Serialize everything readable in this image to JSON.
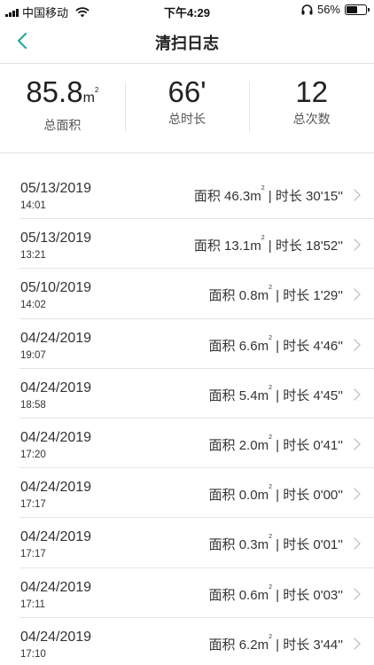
{
  "status_bar": {
    "carrier": "中国移动",
    "time": "下午4:29",
    "battery": "56%",
    "battery_level": 0.56
  },
  "nav": {
    "title": "清扫日志",
    "back_icon": "chevron-left-icon"
  },
  "summary": {
    "area_value": "85.8",
    "area_unit": "m",
    "area_unit_sup": "2",
    "area_label": "总面积",
    "duration_value": "66'",
    "duration_label": "总时长",
    "count_value": "12",
    "count_label": "总次数"
  },
  "colors": {
    "accent": "#2aa89a"
  },
  "logs": [
    {
      "date": "05/13/2019",
      "time": "14:01",
      "area_prefix": "面积 46.3m",
      "sup": "2",
      "duration_text": " | 时长 30'15''"
    },
    {
      "date": "05/13/2019",
      "time": "13:21",
      "area_prefix": "面积 13.1m",
      "sup": "2",
      "duration_text": " | 时长 18'52''"
    },
    {
      "date": "05/10/2019",
      "time": "14:02",
      "area_prefix": "面积 0.8m",
      "sup": "2",
      "duration_text": " | 时长 1'29''"
    },
    {
      "date": "04/24/2019",
      "time": "19:07",
      "area_prefix": "面积 6.6m",
      "sup": "2",
      "duration_text": " | 时长 4'46''"
    },
    {
      "date": "04/24/2019",
      "time": "18:58",
      "area_prefix": "面积 5.4m",
      "sup": "2",
      "duration_text": " | 时长 4'45''"
    },
    {
      "date": "04/24/2019",
      "time": "17:20",
      "area_prefix": "面积 2.0m",
      "sup": "2",
      "duration_text": " | 时长 0'41''"
    },
    {
      "date": "04/24/2019",
      "time": "17:17",
      "area_prefix": "面积 0.0m",
      "sup": "2",
      "duration_text": " | 时长 0'00''"
    },
    {
      "date": "04/24/2019",
      "time": "17:17",
      "area_prefix": "面积 0.3m",
      "sup": "2",
      "duration_text": " | 时长 0'01''"
    },
    {
      "date": "04/24/2019",
      "time": "17:11",
      "area_prefix": "面积 0.6m",
      "sup": "2",
      "duration_text": " | 时长 0'03''"
    },
    {
      "date": "04/24/2019",
      "time": "17:10",
      "area_prefix": "面积 6.2m",
      "sup": "2",
      "duration_text": " | 时长 3'44''"
    }
  ]
}
